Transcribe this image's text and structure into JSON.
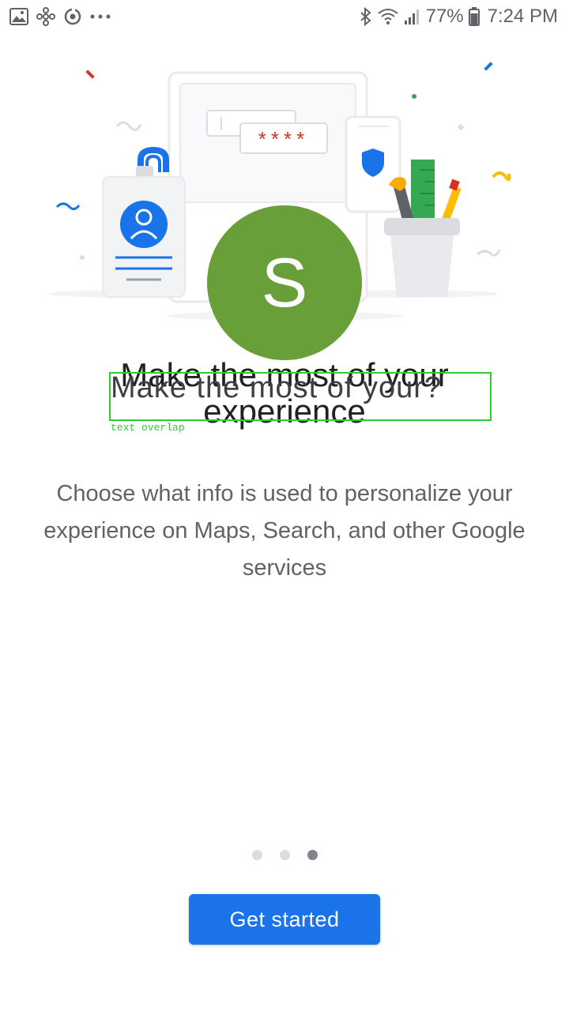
{
  "status_bar": {
    "battery": "77%",
    "time": "7:24 PM",
    "left_icons": [
      "gallery-icon",
      "pinwheel-icon",
      "sync-icon",
      "more-dots-icon"
    ],
    "right_icons": [
      "bluetooth-icon",
      "wifi-icon",
      "signal-icon",
      "battery-icon"
    ]
  },
  "illustration": {
    "avatar_letter": "S",
    "password_mask": "****",
    "colors": {
      "avatar": "#689f38",
      "blue": "#1a73e8",
      "red": "#d93025",
      "green": "#34a853",
      "yellow": "#fbbc04"
    }
  },
  "onboarding": {
    "title": "Make the most of your experience",
    "overlay_text": "Make the most of your?",
    "overlay_label": "text overlap",
    "description": "Choose what info is used to personalize your experience on Maps, Search, and other Google services",
    "page_count": 3,
    "current_page": 3,
    "cta_label": "Get started"
  }
}
